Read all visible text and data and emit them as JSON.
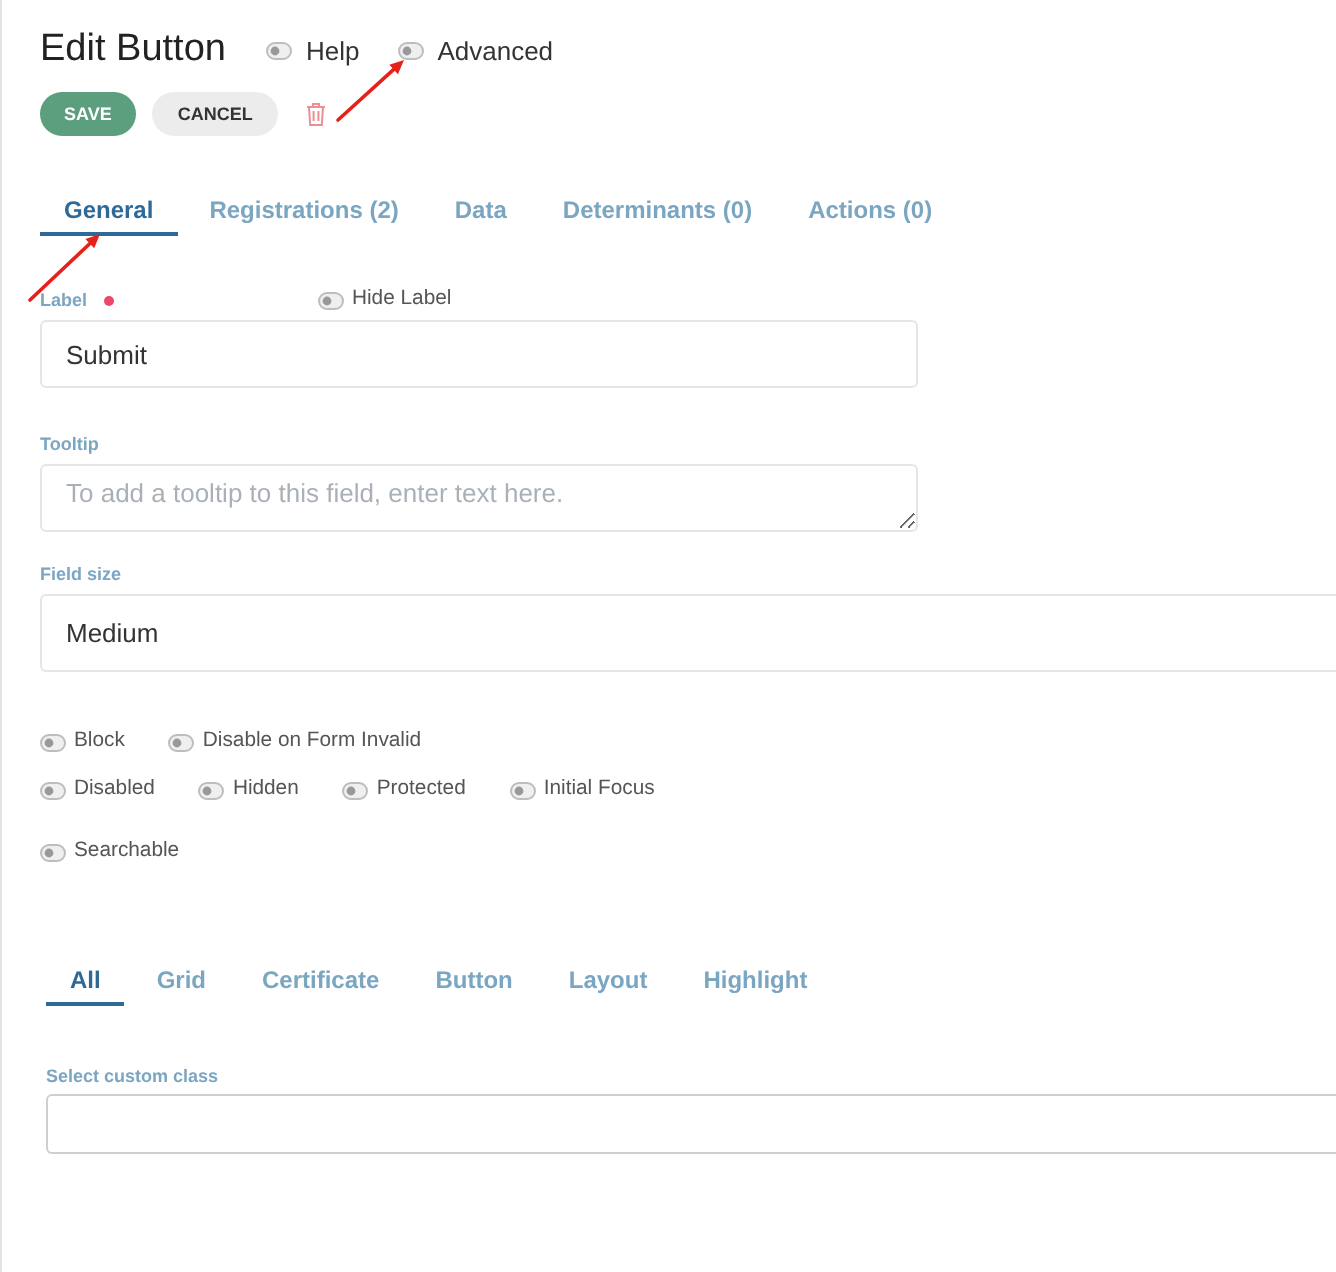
{
  "header": {
    "title": "Edit Button",
    "toggles": [
      {
        "label": "Help",
        "on": false
      },
      {
        "label": "Advanced",
        "on": false
      }
    ]
  },
  "actions": [
    {
      "label": "SAVE",
      "kind": "primary"
    },
    {
      "label": "CANCEL",
      "kind": "secondary"
    }
  ],
  "tabs": [
    {
      "label": "General",
      "selected": true
    },
    {
      "label": "Registrations (2)",
      "selected": false
    },
    {
      "label": "Data",
      "selected": false
    },
    {
      "label": "Determinants (0)",
      "selected": false
    },
    {
      "label": "Actions (0)",
      "selected": false
    }
  ],
  "label_field": {
    "label": "Label",
    "required": true,
    "value": "Submit",
    "hide_label": {
      "label": "Hide Label",
      "on": false
    }
  },
  "tooltip_field": {
    "label": "Tooltip",
    "placeholder": "To add a tooltip to this field, enter text here."
  },
  "field_size": {
    "label": "Field size",
    "value": "Medium"
  },
  "option_rows": [
    {
      "toggles": [
        {
          "label": "Block",
          "on": false
        },
        {
          "label": "Disable on Form Invalid",
          "on": false
        }
      ]
    },
    {
      "toggles": [
        {
          "label": "Disabled",
          "on": false
        },
        {
          "label": "Hidden",
          "on": false
        },
        {
          "label": "Protected",
          "on": false
        },
        {
          "label": "Initial Focus",
          "on": false
        }
      ]
    },
    {
      "toggles": [
        {
          "label": "Searchable",
          "on": false
        }
      ]
    }
  ],
  "class_tabs": [
    {
      "label": "All",
      "selected": true
    },
    {
      "label": "Grid",
      "selected": false
    },
    {
      "label": "Certificate",
      "selected": false
    },
    {
      "label": "Button",
      "selected": false
    },
    {
      "label": "Layout",
      "selected": false
    },
    {
      "label": "Highlight",
      "selected": false
    }
  ],
  "custom_class": {
    "label": "Select custom class"
  }
}
